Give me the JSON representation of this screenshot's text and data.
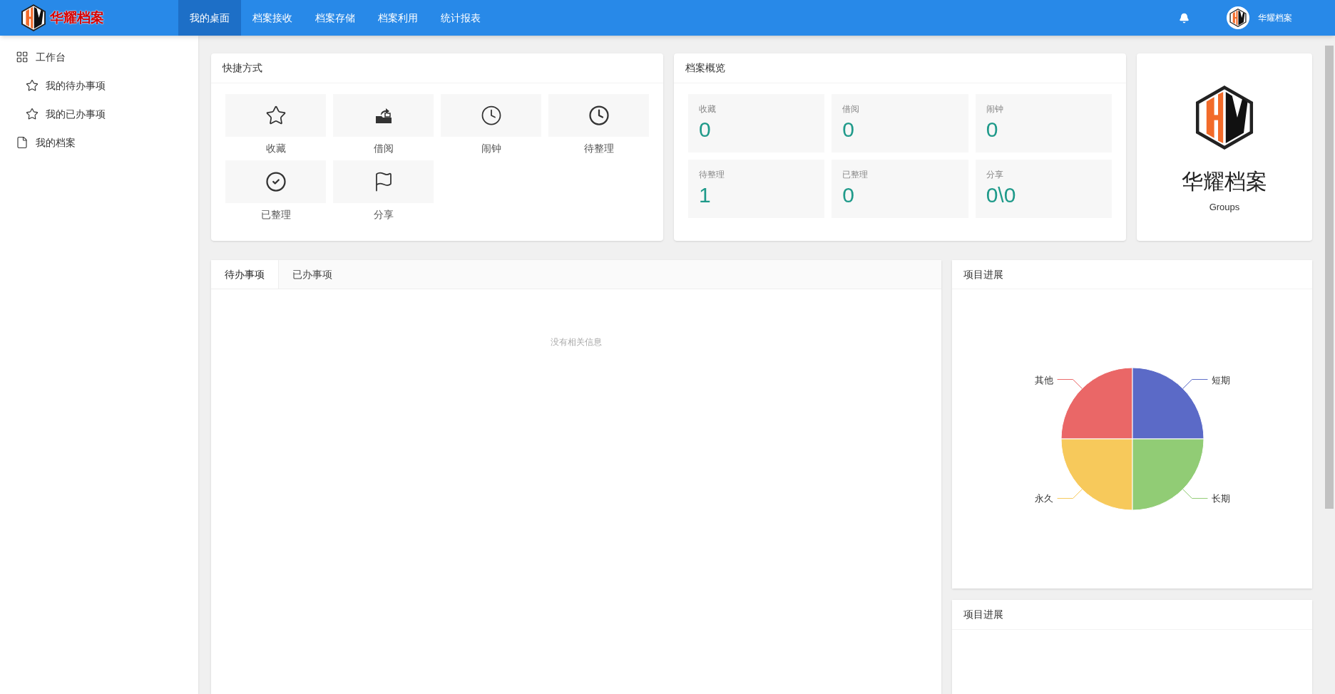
{
  "header": {
    "brand": "华耀档案",
    "nav": [
      {
        "label": "我的桌面",
        "selected": true
      },
      {
        "label": "档案接收",
        "selected": false
      },
      {
        "label": "档案存储",
        "selected": false
      },
      {
        "label": "档案利用",
        "selected": false
      },
      {
        "label": "统计报表",
        "selected": false
      }
    ],
    "user": "华耀档案"
  },
  "sidebar": {
    "items": [
      {
        "label": "工作台",
        "kind": "grid",
        "children": [
          {
            "label": "我的待办事项",
            "kind": "star"
          },
          {
            "label": "我的已办事项",
            "kind": "star"
          }
        ]
      },
      {
        "label": "我的档案",
        "kind": "file"
      }
    ]
  },
  "shortcuts": {
    "title": "快捷方式",
    "items": [
      {
        "label": "收藏",
        "kind": "star"
      },
      {
        "label": "借阅",
        "kind": "borrow"
      },
      {
        "label": "闹钟",
        "kind": "clock"
      },
      {
        "label": "待整理",
        "kind": "pending"
      },
      {
        "label": "已整理",
        "kind": "check"
      },
      {
        "label": "分享",
        "kind": "flag"
      }
    ]
  },
  "overview": {
    "title": "档案概览",
    "stats": [
      {
        "label": "收藏",
        "value": "0"
      },
      {
        "label": "借阅",
        "value": "0"
      },
      {
        "label": "闹钟",
        "value": "0"
      },
      {
        "label": "待整理",
        "value": "1"
      },
      {
        "label": "已整理",
        "value": "0"
      },
      {
        "label": "分享",
        "value": "0\\0"
      }
    ]
  },
  "brand_card": {
    "name": "华耀档案",
    "subtitle": "Groups"
  },
  "tasks": {
    "tabs": [
      {
        "label": "待办事项",
        "selected": true
      },
      {
        "label": "已办事项",
        "selected": false
      }
    ],
    "empty_text": "没有相关信息"
  },
  "progress": {
    "title": "项目进展",
    "slices": [
      {
        "label": "其他",
        "color": "#ea6767"
      },
      {
        "label": "短期",
        "color": "#5b6ac7"
      },
      {
        "label": "永久",
        "color": "#f7c95b"
      },
      {
        "label": "长期",
        "color": "#91cc75"
      }
    ]
  },
  "progress_2": {
    "title": "项目进展"
  }
}
